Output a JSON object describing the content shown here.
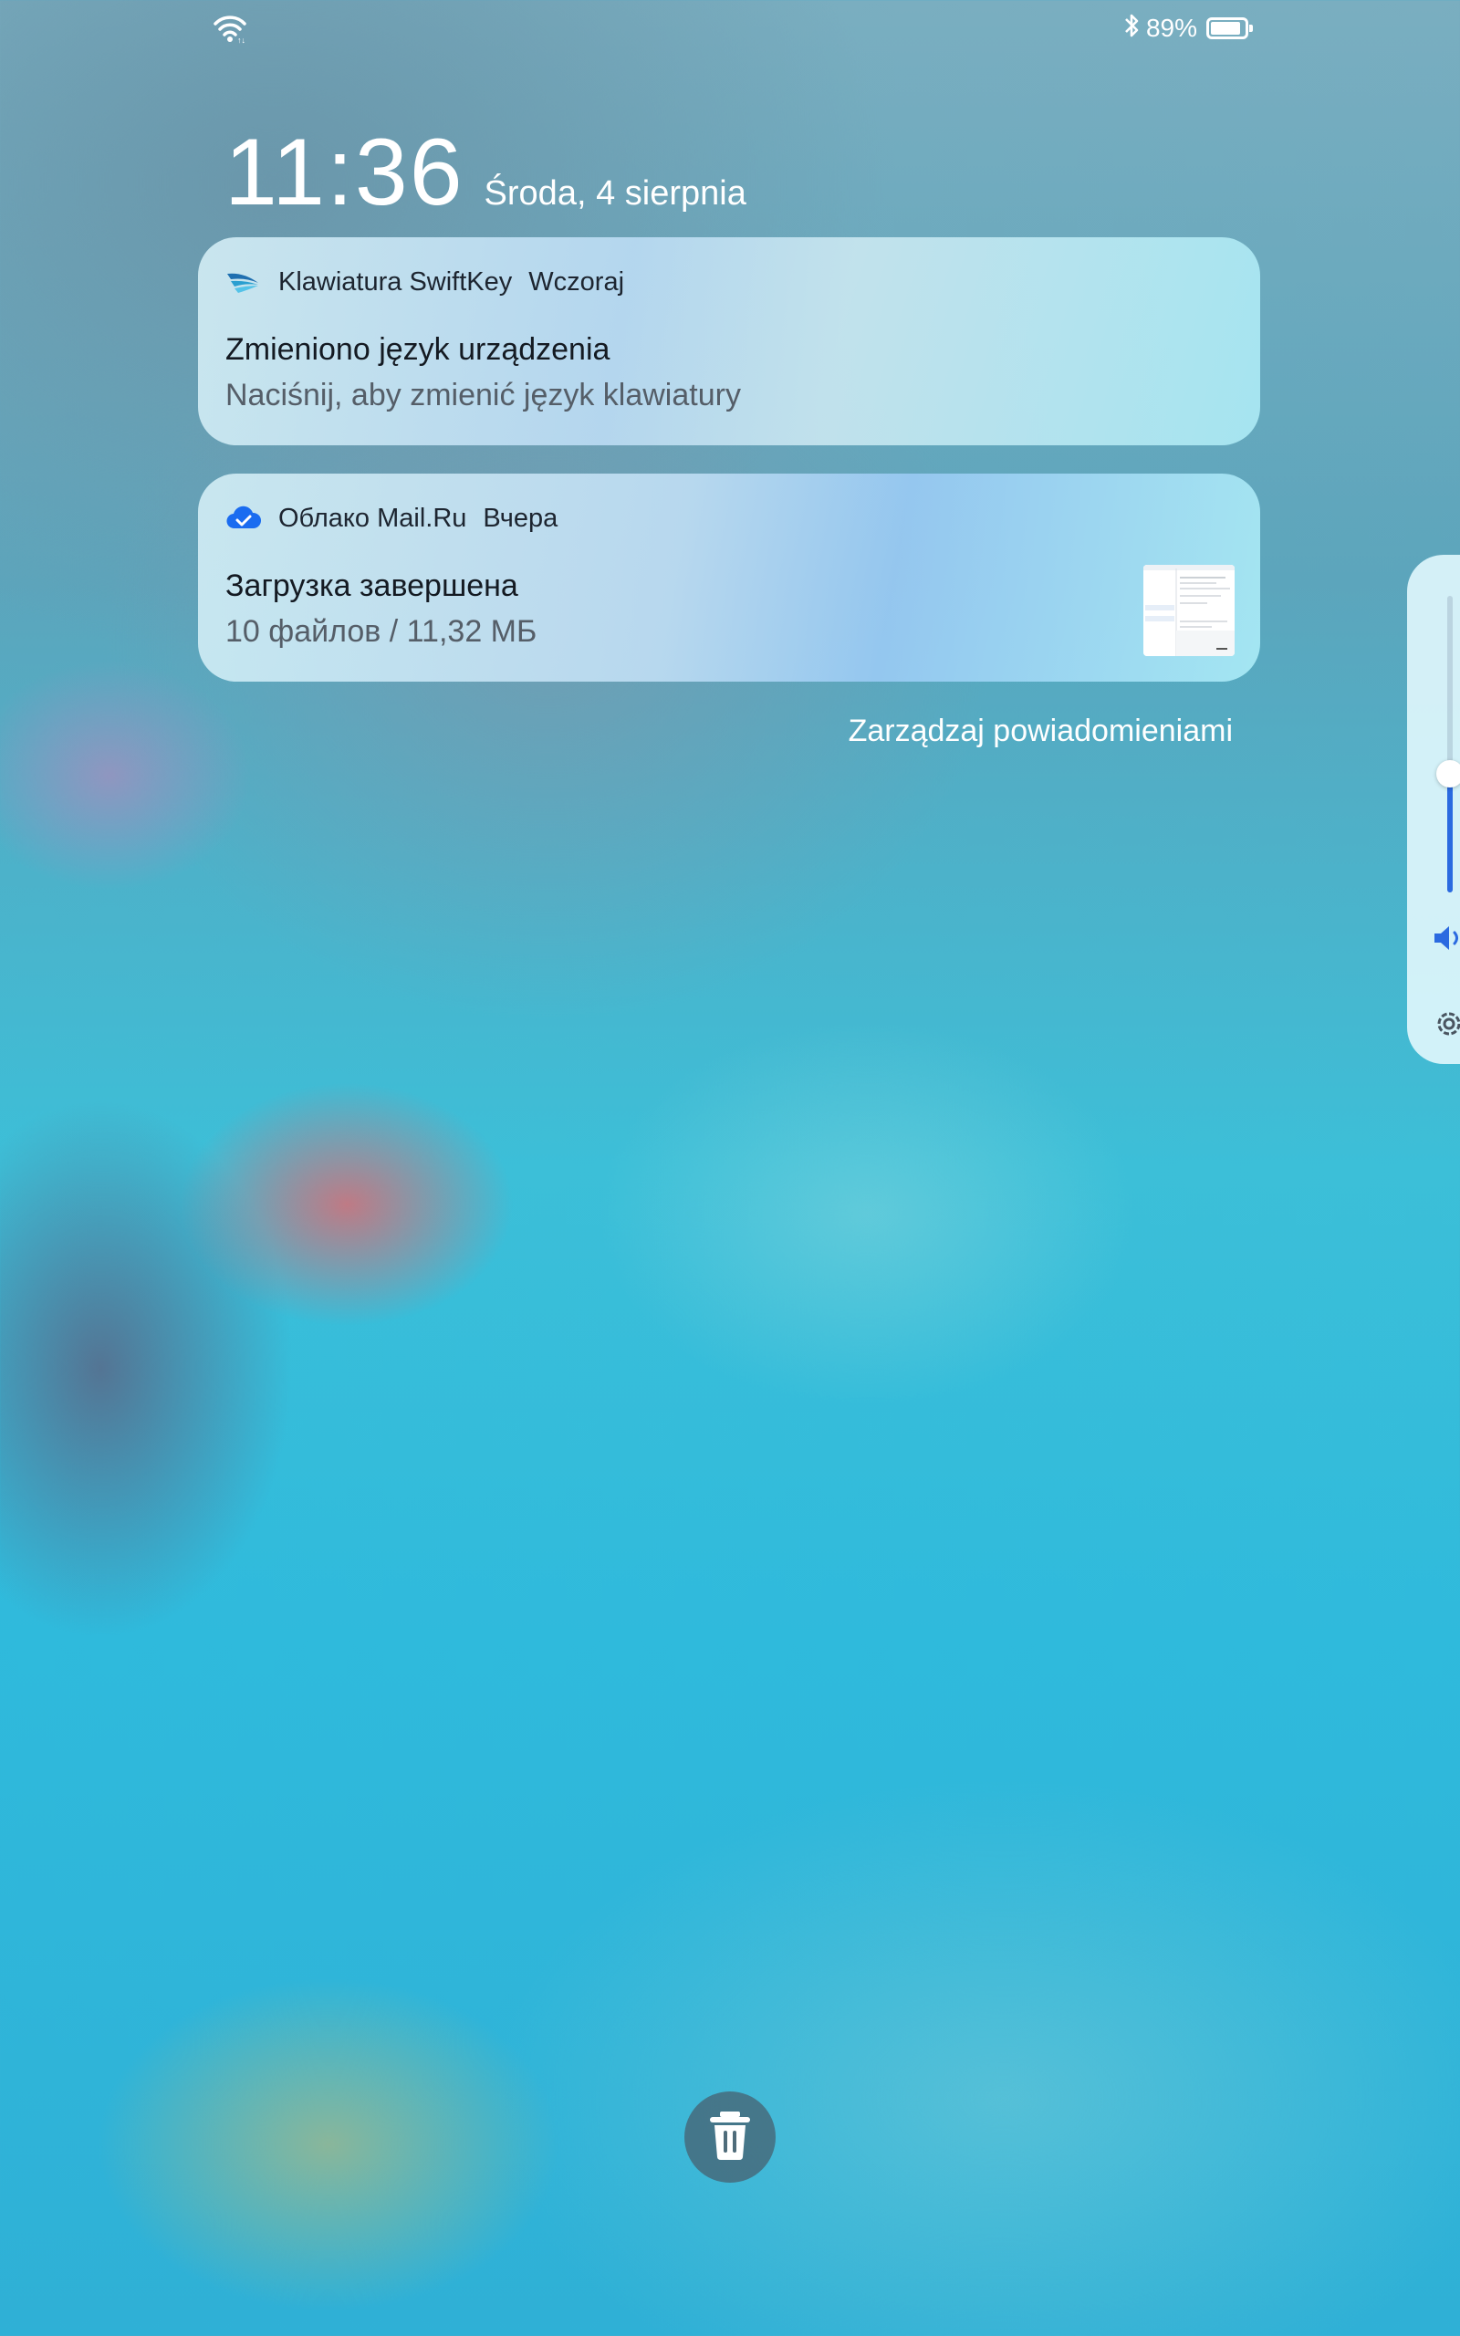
{
  "status_bar": {
    "wifi_icon": "wifi-icon",
    "bluetooth_icon": "bluetooth-icon",
    "battery_percent": "89%",
    "battery_level": 0.89
  },
  "lockscreen": {
    "time": "11:36",
    "date": "Środa, 4 sierpnia"
  },
  "notifications": [
    {
      "app_name": "Klawiatura SwiftKey",
      "timestamp": "Wczoraj",
      "title": "Zmieniono język urządzenia",
      "body": "Naciśnij, aby zmienić język klawiatury",
      "icon": "swiftkey-icon"
    },
    {
      "app_name": "Облако Mail.Ru",
      "timestamp": "Вчера",
      "title": "Загрузка завершена",
      "body": "10 файлов / 11,32 МБ",
      "icon": "cloud-check-icon"
    }
  ],
  "manage_notifications_label": "Zarządzaj powiadomieniami",
  "volume": {
    "level": 0.4,
    "accent": "#2b6ae0"
  },
  "colors": {
    "accent_blue": "#2b6ae0",
    "text_primary": "#141a22",
    "text_secondary": "#555e68"
  }
}
